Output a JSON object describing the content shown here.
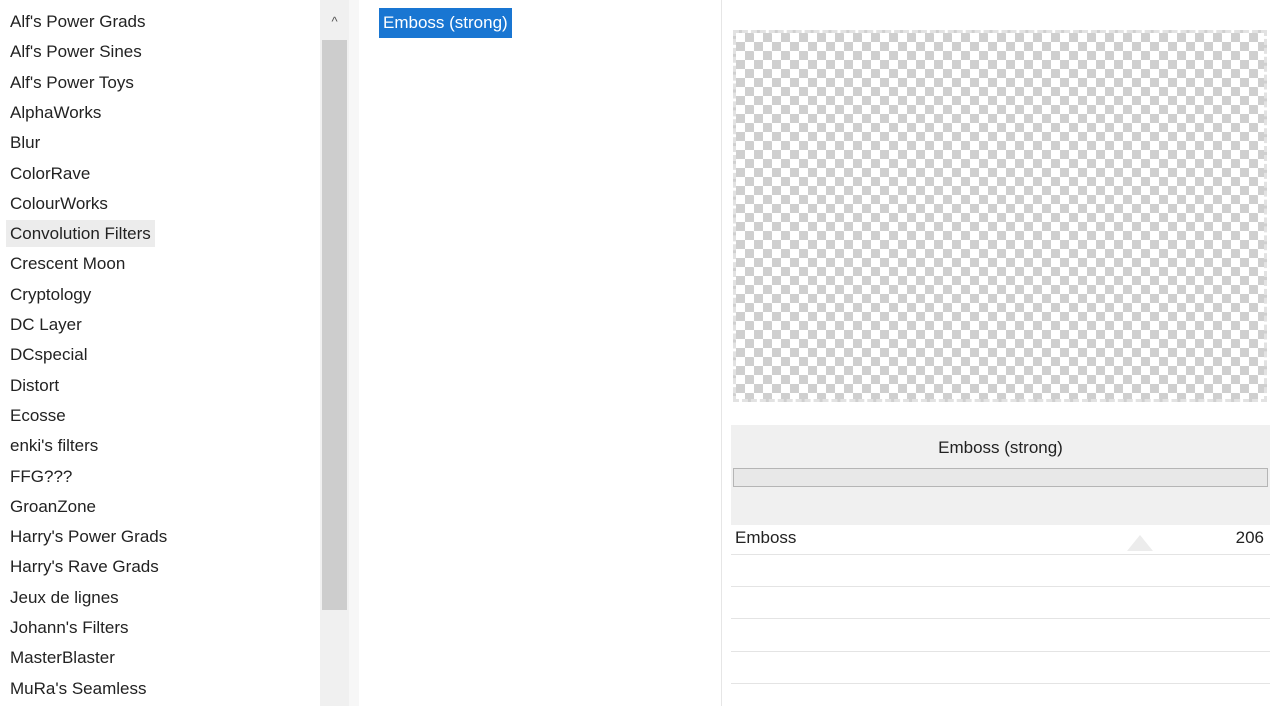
{
  "categories": {
    "items": [
      "Alf's Power Grads",
      "Alf's Power Sines",
      "Alf's Power Toys",
      "AlphaWorks",
      "Blur",
      "ColorRave",
      "ColourWorks",
      "Convolution Filters",
      "Crescent Moon",
      "Cryptology",
      "DC Layer",
      "DCspecial",
      "Distort",
      "Ecosse",
      "enki's filters",
      "FFG???",
      "GroanZone",
      "Harry's Power Grads",
      "Harry's Rave Grads",
      "Jeux de lignes",
      "Johann's Filters",
      "MasterBlaster",
      "MuRa's Seamless"
    ],
    "selected_index": 7
  },
  "scrollbar": {
    "up_arrow_icon": "chevron-up-icon",
    "up_glyph": "^"
  },
  "filters": {
    "items": [
      "Emboss (strong)"
    ],
    "selected_index": 0
  },
  "preview": {
    "title": "Emboss (strong)",
    "progress": 0
  },
  "params": [
    {
      "name": "Emboss",
      "value": "206",
      "max": 255
    },
    {
      "name": "",
      "value": ""
    },
    {
      "name": "",
      "value": ""
    },
    {
      "name": "",
      "value": ""
    },
    {
      "name": "",
      "value": ""
    }
  ],
  "colors": {
    "selection": "#1976d2",
    "hover": "#ececec"
  }
}
